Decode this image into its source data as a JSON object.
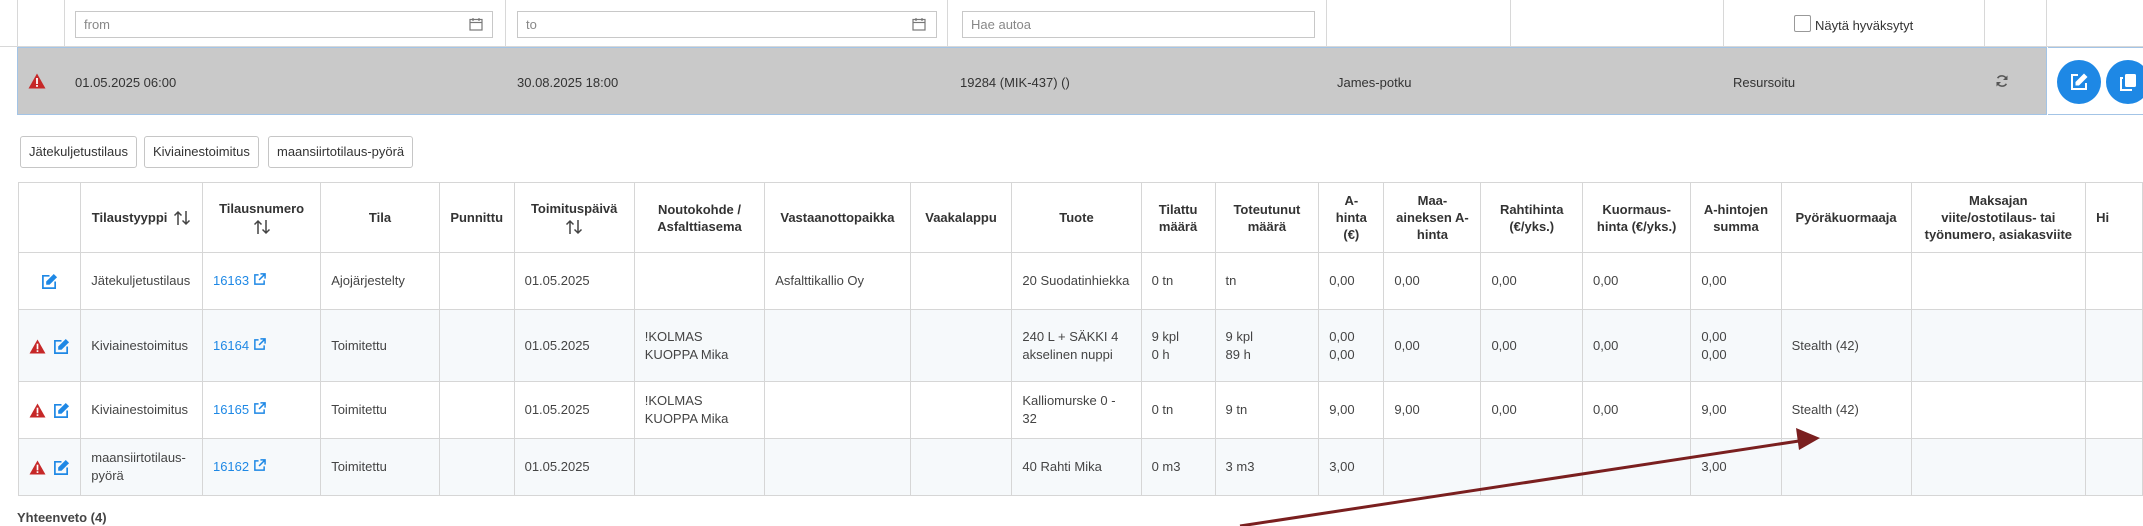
{
  "filters": {
    "from_placeholder": "from",
    "to_placeholder": "to",
    "car_search_placeholder": "Hae autoa",
    "show_approved_label": "Näytä hyväksytyt"
  },
  "selected_row": {
    "start": "01.05.2025 06:00",
    "end": "30.08.2025 18:00",
    "vehicle": "19284 (MIK-437) ()",
    "driver": "James-potku",
    "status": "Resursoitu"
  },
  "tags": [
    "Jätekuljetustilaus",
    "Kiviainestoimitus",
    "maansiirtotilaus-pyörä"
  ],
  "table": {
    "headers": {
      "type": "Tilaustyyppi",
      "number": "Tilausnumero",
      "state": "Tila",
      "weighed": "Punnittu",
      "delivery_date": "Toimituspäivä",
      "pickup": "Noutokohde / Asfalttiasema",
      "receiver": "Vastaanottopaikka",
      "scale_note": "Vaakalappu",
      "product": "Tuote",
      "ordered_qty": "Tilattu määrä",
      "realized_qty": "Toteutunut määrä",
      "unit_price": "A-hinta (€)",
      "material_price": "Maa-aineksen A-hinta",
      "freight_price": "Rahtihinta (€/yks.)",
      "loading_price": "Kuormaus-hinta (€/yks.)",
      "price_sum": "A-hintojen summa",
      "wheel_loader": "Pyöräkuormaaja",
      "payer_ref": "Maksajan viite/ostotilaus- tai työnumero, asiakasviite",
      "more": "Hi"
    },
    "rows": [
      {
        "warning": false,
        "type": "Jätekuljetustilaus",
        "number": "16163",
        "state": "Ajojärjestelty",
        "weighed": "",
        "delivery_date": "01.05.2025",
        "pickup": "",
        "receiver": "Asfalttikallio Oy",
        "scale_note": "",
        "product": "20 Suodatinhiekka",
        "ordered_qty": "0 tn",
        "realized_qty": "tn",
        "unit_price": "0,00",
        "material_price": "0,00",
        "freight_price": "0,00",
        "loading_price": "0,00",
        "price_sum": "0,00",
        "wheel_loader": "",
        "payer_ref": ""
      },
      {
        "warning": true,
        "type": "Kiviainestoimitus",
        "number": "16164",
        "state": "Toimitettu",
        "weighed": "",
        "delivery_date": "01.05.2025",
        "pickup": "!KOLMAS KUOPPA Mika",
        "receiver": "",
        "scale_note": "",
        "product": "240 L + SÄKKI 4 akselinen nuppi",
        "ordered_qty": "9 kpl\n0 h",
        "realized_qty": "9 kpl\n89 h",
        "unit_price": "0,00\n0,00",
        "material_price": "0,00",
        "freight_price": "0,00",
        "loading_price": "0,00",
        "price_sum": "0,00\n0,00",
        "wheel_loader": "Stealth (42)",
        "payer_ref": ""
      },
      {
        "warning": true,
        "type": "Kiviainestoimitus",
        "number": "16165",
        "state": "Toimitettu",
        "weighed": "",
        "delivery_date": "01.05.2025",
        "pickup": "!KOLMAS KUOPPA Mika",
        "receiver": "",
        "scale_note": "",
        "product": "Kalliomurske 0 - 32",
        "ordered_qty": "0 tn",
        "realized_qty": "9 tn",
        "unit_price": "9,00",
        "material_price": "9,00",
        "freight_price": "0,00",
        "loading_price": "0,00",
        "price_sum": "9,00",
        "wheel_loader": "Stealth (42)",
        "payer_ref": ""
      },
      {
        "warning": true,
        "type": "maansiirtotilaus-pyörä",
        "number": "16162",
        "state": "Toimitettu",
        "weighed": "",
        "delivery_date": "01.05.2025",
        "pickup": "",
        "receiver": "",
        "scale_note": "",
        "product": "40 Rahti Mika",
        "ordered_qty": "0 m3",
        "realized_qty": "3 m3",
        "unit_price": "3,00",
        "material_price": "",
        "freight_price": "",
        "loading_price": "",
        "price_sum": "3,00",
        "wheel_loader": "",
        "payer_ref": ""
      }
    ]
  },
  "summary": "Yhteenveto (4)",
  "colors": {
    "accent": "#1e88e5",
    "warning": "#c62828",
    "annotation_arrow": "#7a1f1f",
    "selected_row": "#c9c9c9"
  }
}
